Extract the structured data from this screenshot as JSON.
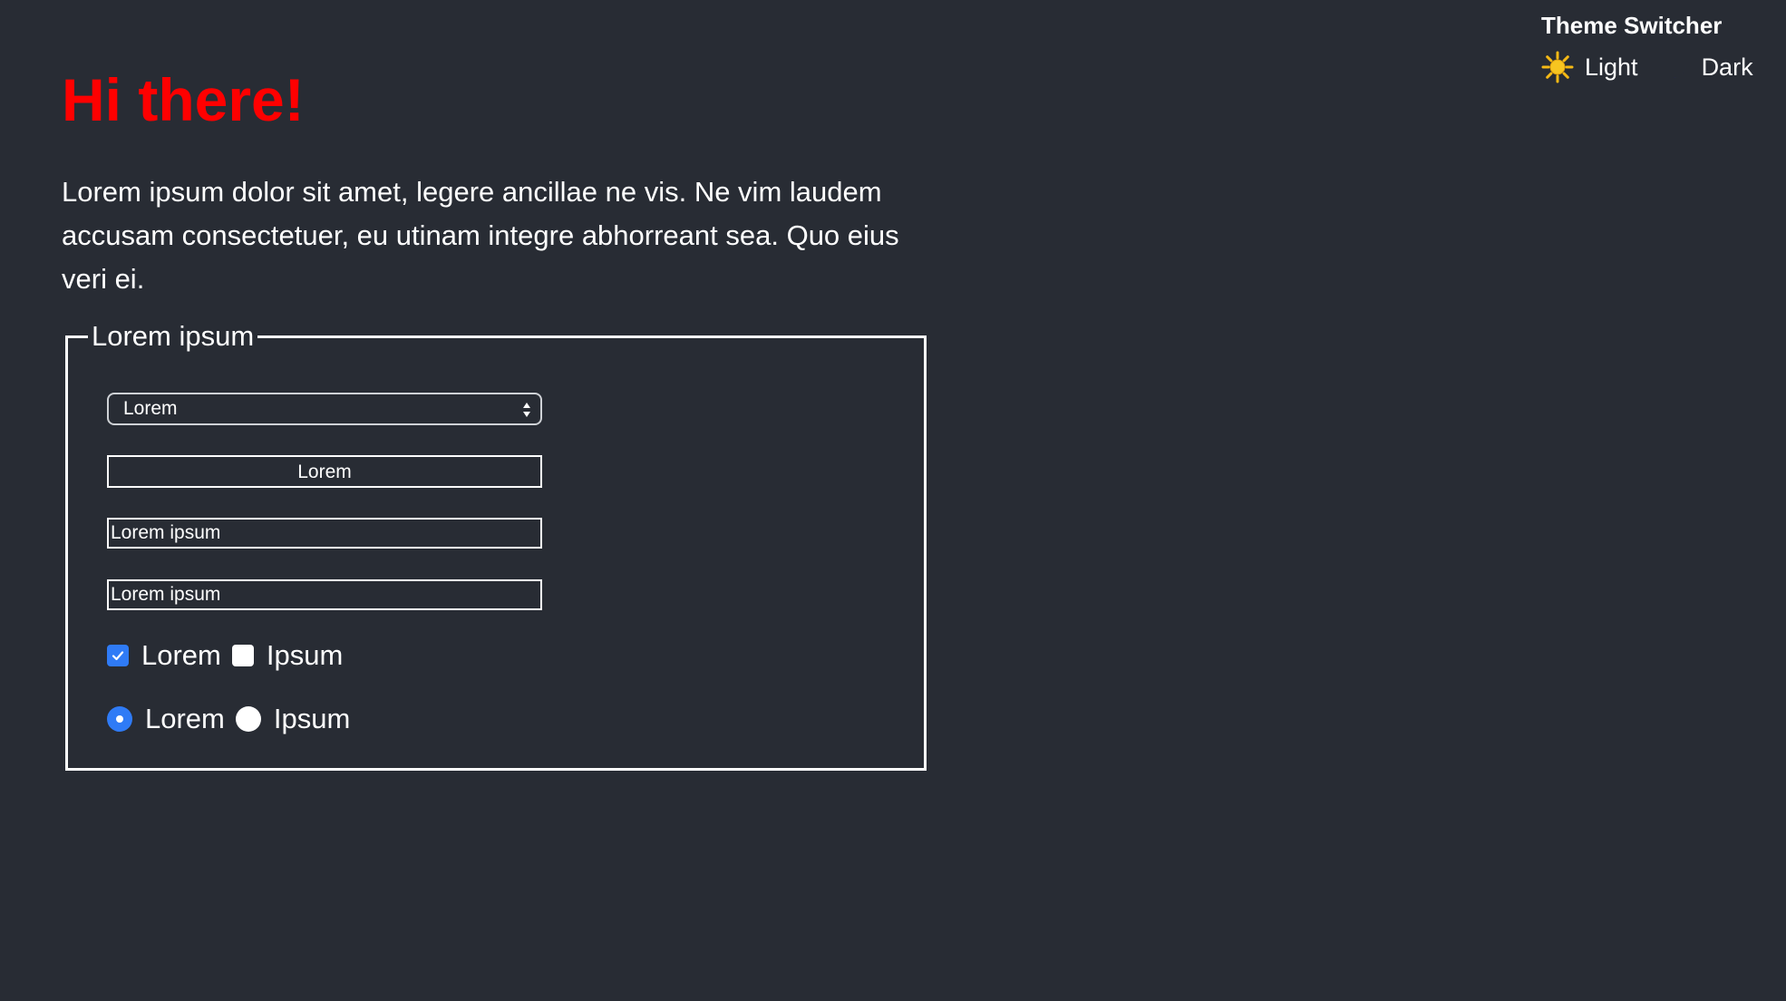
{
  "theme_switcher": {
    "title": "Theme Switcher",
    "options": [
      {
        "label": "Light",
        "icon": "sun-icon",
        "color": "#f5b915"
      },
      {
        "label": "Dark",
        "icon": "moon-icon",
        "color": "#1a1aa8"
      }
    ]
  },
  "main": {
    "heading": "Hi there!",
    "heading_color": "#ff0000",
    "paragraph": "Lorem ipsum dolor sit amet, legere ancillae ne vis. Ne vim laudem accusam consectetuer, eu utinam integre abhorreant sea. Quo eius veri ei."
  },
  "form": {
    "legend": "Lorem ipsum",
    "select_value": "Lorem",
    "button_label": "Lorem",
    "input1_value": "Lorem ipsum",
    "input2_value": "Lorem ipsum",
    "checkboxes": [
      {
        "label": "Lorem",
        "checked": true
      },
      {
        "label": "Ipsum",
        "checked": false
      }
    ],
    "radios": [
      {
        "label": "Lorem",
        "checked": true
      },
      {
        "label": "Ipsum",
        "checked": false
      }
    ],
    "accent_color": "#2f7bf6"
  },
  "colors": {
    "background": "#282c34",
    "text": "#ffffff"
  }
}
